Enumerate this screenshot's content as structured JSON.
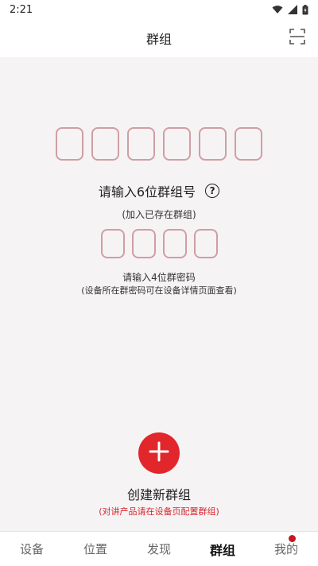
{
  "status_bar": {
    "time": "2:21"
  },
  "header": {
    "title": "群组",
    "scan_icon": "scan-icon"
  },
  "join": {
    "group_code_length": 6,
    "prompt": "请输入6位群组号",
    "help_icon_glyph": "?",
    "sub_prompt": "(加入已存在群组)",
    "password_length": 4,
    "password_prompt": "请输入4位群密码",
    "password_hint": "(设备所在群密码可在设备详情页面查看)"
  },
  "create": {
    "button_icon": "plus-icon",
    "label": "创建新群组",
    "hint": "(对讲产品请在设备页配置群组)"
  },
  "nav": {
    "items": [
      {
        "label": "设备"
      },
      {
        "label": "位置"
      },
      {
        "label": "发现"
      },
      {
        "label": "群组"
      },
      {
        "label": "我的"
      }
    ],
    "active_index": 3
  },
  "colors": {
    "accent": "#e1272c",
    "box_border": "#cf9ea2",
    "background": "#f6f3f5"
  }
}
